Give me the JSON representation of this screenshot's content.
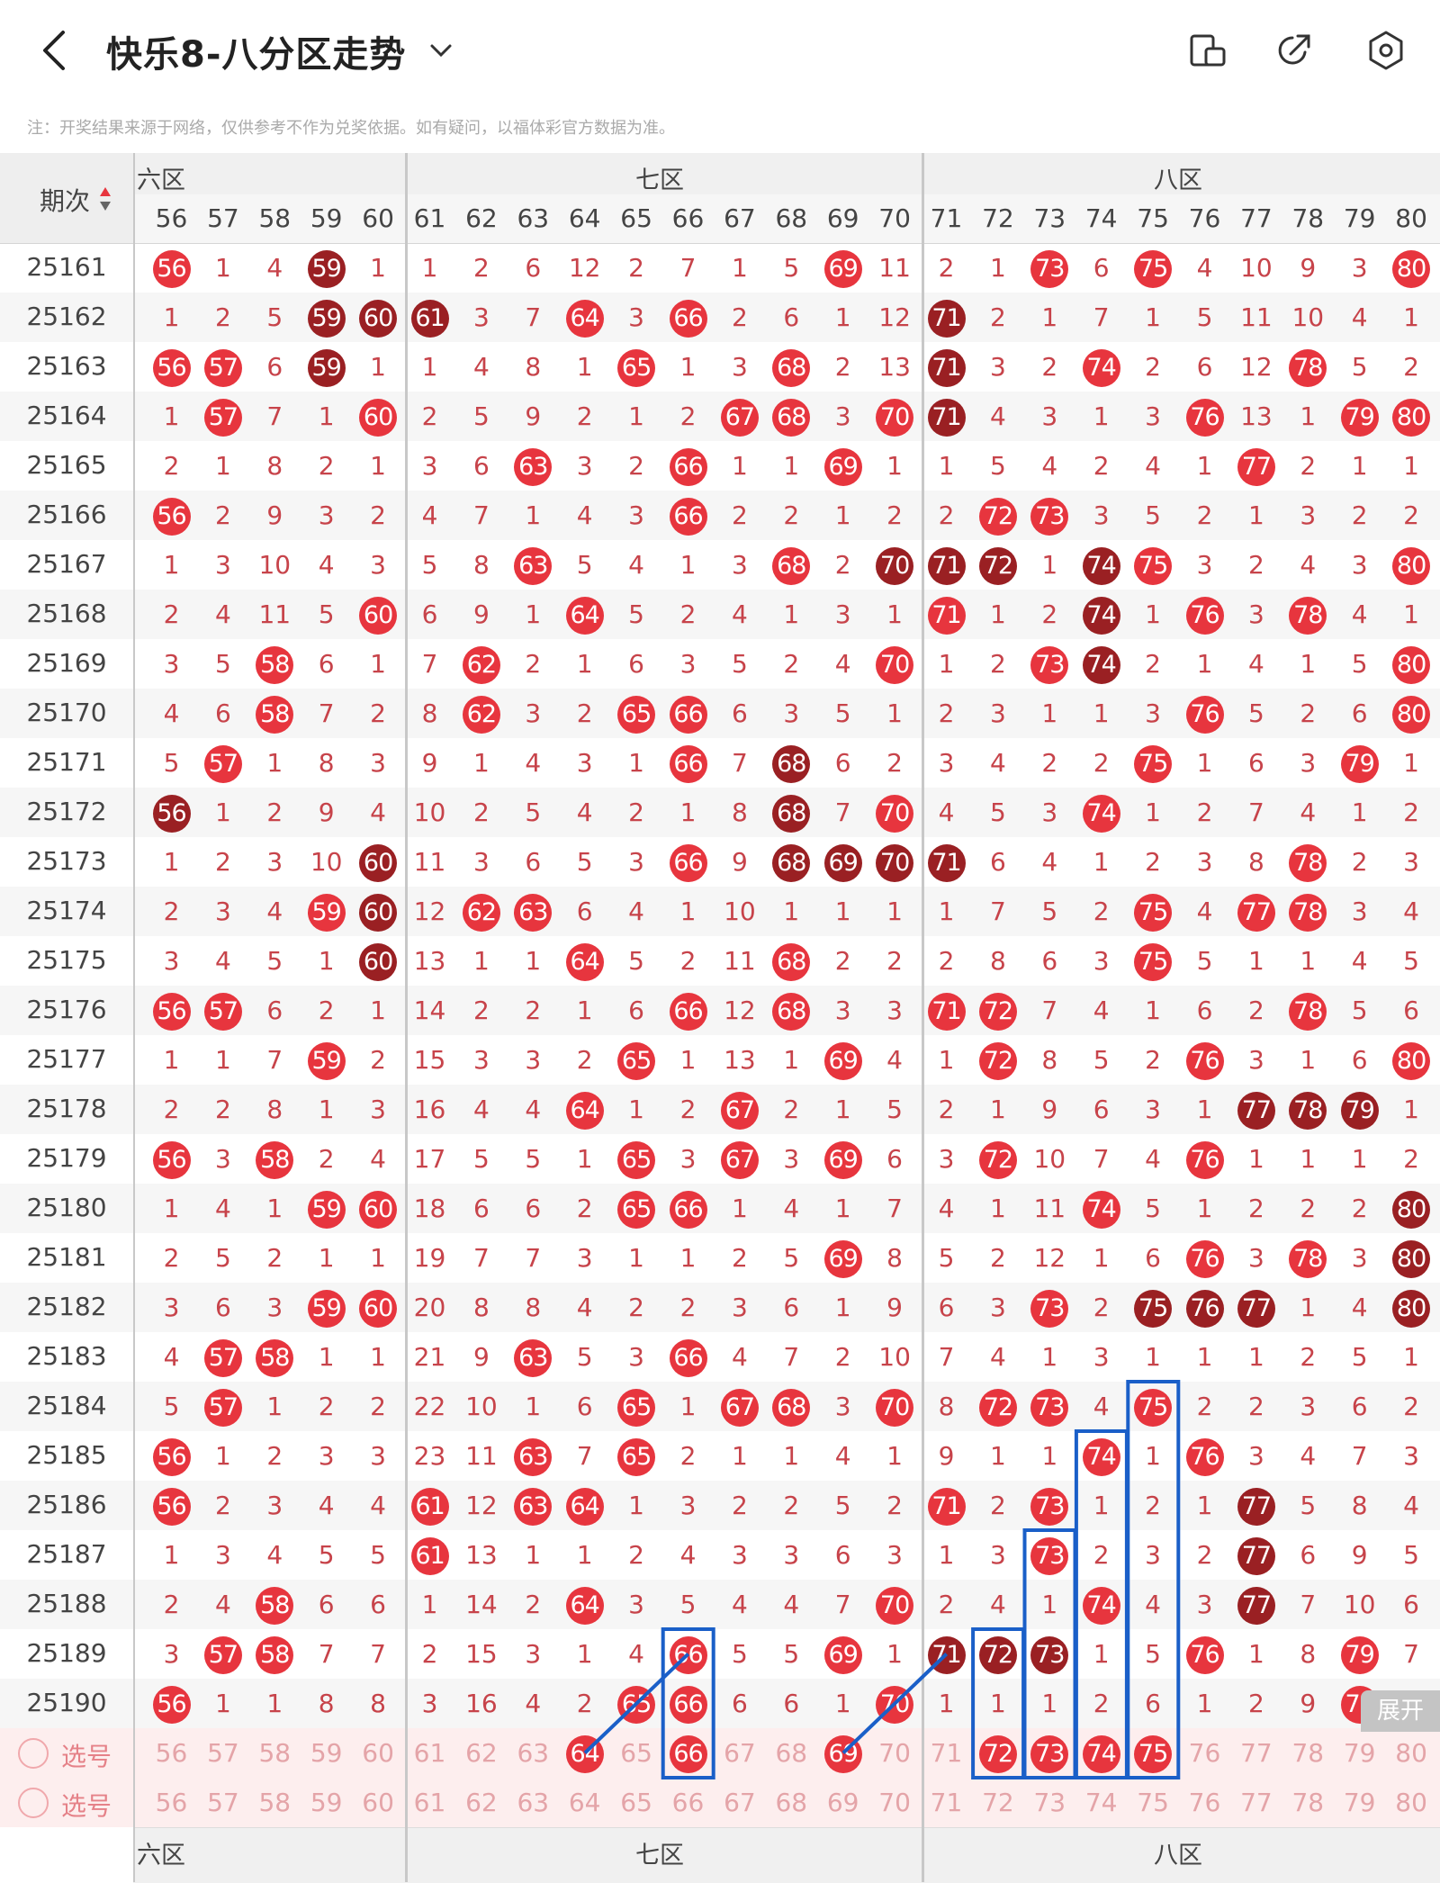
{
  "header": {
    "title": "快乐8-八分区走势",
    "back_icon": "chevron-left-icon",
    "dropdown_icon": "chevron-down-icon",
    "icons": [
      "tablet-icon",
      "share-icon",
      "settings-icon"
    ]
  },
  "note": "注：开奖结果来源于网络，仅供参考不作为兑奖依据。如有疑问，以福体彩官方数据为准。",
  "table": {
    "issue_header": "期次",
    "zones": [
      {
        "label": "六区"
      },
      {
        "label": "七区"
      },
      {
        "label": "八区"
      }
    ],
    "columns": [
      "56",
      "57",
      "58",
      "59",
      "60",
      "61",
      "62",
      "63",
      "64",
      "65",
      "66",
      "67",
      "68",
      "69",
      "70",
      "71",
      "72",
      "73",
      "74",
      "75",
      "76",
      "77",
      "78",
      "79",
      "80"
    ],
    "rows": [
      {
        "issue": "25161",
        "cells": [
          "56r",
          "1",
          "4",
          "59d",
          "1",
          "1",
          "2",
          "6",
          "12",
          "2",
          "7",
          "1",
          "5",
          "69r",
          "11",
          "2",
          "1",
          "73r",
          "6",
          "75r",
          "4",
          "10",
          "9",
          "3",
          "80r"
        ]
      },
      {
        "issue": "25162",
        "cells": [
          "1",
          "2",
          "5",
          "59d",
          "60d",
          "61d",
          "3",
          "7",
          "64r",
          "3",
          "66r",
          "2",
          "6",
          "1",
          "12",
          "71d",
          "2",
          "1",
          "7",
          "1",
          "5",
          "11",
          "10",
          "4",
          "1"
        ]
      },
      {
        "issue": "25163",
        "cells": [
          "56r",
          "57r",
          "6",
          "59d",
          "1",
          "1",
          "4",
          "8",
          "1",
          "65r",
          "1",
          "3",
          "68r",
          "2",
          "13",
          "71d",
          "3",
          "2",
          "74r",
          "2",
          "6",
          "12",
          "78r",
          "5",
          "2"
        ]
      },
      {
        "issue": "25164",
        "cells": [
          "1",
          "57r",
          "7",
          "1",
          "60r",
          "2",
          "5",
          "9",
          "2",
          "1",
          "2",
          "67r",
          "68r",
          "3",
          "70r",
          "71d",
          "4",
          "3",
          "1",
          "3",
          "76r",
          "13",
          "1",
          "79r",
          "80r"
        ]
      },
      {
        "issue": "25165",
        "cells": [
          "2",
          "1",
          "8",
          "2",
          "1",
          "3",
          "6",
          "63r",
          "3",
          "2",
          "66r",
          "1",
          "1",
          "69r",
          "1",
          "1",
          "5",
          "4",
          "2",
          "4",
          "1",
          "77r",
          "2",
          "1",
          "1"
        ]
      },
      {
        "issue": "25166",
        "cells": [
          "56r",
          "2",
          "9",
          "3",
          "2",
          "4",
          "7",
          "1",
          "4",
          "3",
          "66r",
          "2",
          "2",
          "1",
          "2",
          "2",
          "72r",
          "73r",
          "3",
          "5",
          "2",
          "1",
          "3",
          "2",
          "2"
        ]
      },
      {
        "issue": "25167",
        "cells": [
          "1",
          "3",
          "10",
          "4",
          "3",
          "5",
          "8",
          "63r",
          "5",
          "4",
          "1",
          "3",
          "68r",
          "2",
          "70d",
          "71d",
          "72d",
          "1",
          "74d",
          "75r",
          "3",
          "2",
          "4",
          "3",
          "80r"
        ]
      },
      {
        "issue": "25168",
        "cells": [
          "2",
          "4",
          "11",
          "5",
          "60r",
          "6",
          "9",
          "1",
          "64r",
          "5",
          "2",
          "4",
          "1",
          "3",
          "1",
          "71r",
          "1",
          "2",
          "74d",
          "1",
          "76r",
          "3",
          "78r",
          "4",
          "1"
        ]
      },
      {
        "issue": "25169",
        "cells": [
          "3",
          "5",
          "58r",
          "6",
          "1",
          "7",
          "62r",
          "2",
          "1",
          "6",
          "3",
          "5",
          "2",
          "4",
          "70r",
          "1",
          "2",
          "73r",
          "74d",
          "2",
          "1",
          "4",
          "1",
          "5",
          "80r"
        ]
      },
      {
        "issue": "25170",
        "cells": [
          "4",
          "6",
          "58r",
          "7",
          "2",
          "8",
          "62r",
          "3",
          "2",
          "65r",
          "66r",
          "6",
          "3",
          "5",
          "1",
          "2",
          "3",
          "1",
          "1",
          "3",
          "76r",
          "5",
          "2",
          "6",
          "80r"
        ]
      },
      {
        "issue": "25171",
        "cells": [
          "5",
          "57r",
          "1",
          "8",
          "3",
          "9",
          "1",
          "4",
          "3",
          "1",
          "66r",
          "7",
          "68d",
          "6",
          "2",
          "3",
          "4",
          "2",
          "2",
          "75r",
          "1",
          "6",
          "3",
          "79r",
          "1"
        ]
      },
      {
        "issue": "25172",
        "cells": [
          "56d",
          "1",
          "2",
          "9",
          "4",
          "10",
          "2",
          "5",
          "4",
          "2",
          "1",
          "8",
          "68d",
          "7",
          "70r",
          "4",
          "5",
          "3",
          "74r",
          "1",
          "2",
          "7",
          "4",
          "1",
          "2"
        ]
      },
      {
        "issue": "25173",
        "cells": [
          "1",
          "2",
          "3",
          "10",
          "60d",
          "11",
          "3",
          "6",
          "5",
          "3",
          "66r",
          "9",
          "68d",
          "69d",
          "70d",
          "71d",
          "6",
          "4",
          "1",
          "2",
          "3",
          "8",
          "78r",
          "2",
          "3"
        ]
      },
      {
        "issue": "25174",
        "cells": [
          "2",
          "3",
          "4",
          "59r",
          "60d",
          "12",
          "62r",
          "63r",
          "6",
          "4",
          "1",
          "10",
          "1",
          "1",
          "1",
          "1",
          "7",
          "5",
          "2",
          "75r",
          "4",
          "77r",
          "78r",
          "3",
          "4"
        ]
      },
      {
        "issue": "25175",
        "cells": [
          "3",
          "4",
          "5",
          "1",
          "60d",
          "13",
          "1",
          "1",
          "64r",
          "5",
          "2",
          "11",
          "68r",
          "2",
          "2",
          "2",
          "8",
          "6",
          "3",
          "75r",
          "5",
          "1",
          "1",
          "4",
          "5"
        ]
      },
      {
        "issue": "25176",
        "cells": [
          "56r",
          "57r",
          "6",
          "2",
          "1",
          "14",
          "2",
          "2",
          "1",
          "6",
          "66r",
          "12",
          "68r",
          "3",
          "3",
          "71r",
          "72r",
          "7",
          "4",
          "1",
          "6",
          "2",
          "78r",
          "5",
          "6"
        ]
      },
      {
        "issue": "25177",
        "cells": [
          "1",
          "1",
          "7",
          "59r",
          "2",
          "15",
          "3",
          "3",
          "2",
          "65r",
          "1",
          "13",
          "1",
          "69r",
          "4",
          "1",
          "72r",
          "8",
          "5",
          "2",
          "76r",
          "3",
          "1",
          "6",
          "80r"
        ]
      },
      {
        "issue": "25178",
        "cells": [
          "2",
          "2",
          "8",
          "1",
          "3",
          "16",
          "4",
          "4",
          "64r",
          "1",
          "2",
          "67r",
          "2",
          "1",
          "5",
          "2",
          "1",
          "9",
          "6",
          "3",
          "1",
          "77d",
          "78d",
          "79d",
          "1"
        ]
      },
      {
        "issue": "25179",
        "cells": [
          "56r",
          "3",
          "58r",
          "2",
          "4",
          "17",
          "5",
          "5",
          "1",
          "65r",
          "3",
          "67r",
          "3",
          "69r",
          "6",
          "3",
          "72r",
          "10",
          "7",
          "4",
          "76r",
          "1",
          "1",
          "1",
          "2"
        ]
      },
      {
        "issue": "25180",
        "cells": [
          "1",
          "4",
          "1",
          "59r",
          "60r",
          "18",
          "6",
          "6",
          "2",
          "65r",
          "66r",
          "1",
          "4",
          "1",
          "7",
          "4",
          "1",
          "11",
          "74r",
          "5",
          "1",
          "2",
          "2",
          "2",
          "80d"
        ]
      },
      {
        "issue": "25181",
        "cells": [
          "2",
          "5",
          "2",
          "1",
          "1",
          "19",
          "7",
          "7",
          "3",
          "1",
          "1",
          "2",
          "5",
          "69r",
          "8",
          "5",
          "2",
          "12",
          "1",
          "6",
          "76r",
          "3",
          "78r",
          "3",
          "80d"
        ]
      },
      {
        "issue": "25182",
        "cells": [
          "3",
          "6",
          "3",
          "59r",
          "60r",
          "20",
          "8",
          "8",
          "4",
          "2",
          "2",
          "3",
          "6",
          "1",
          "9",
          "6",
          "3",
          "73r",
          "2",
          "75d",
          "76d",
          "77d",
          "1",
          "4",
          "80d"
        ]
      },
      {
        "issue": "25183",
        "cells": [
          "4",
          "57r",
          "58r",
          "1",
          "1",
          "21",
          "9",
          "63r",
          "5",
          "3",
          "66r",
          "4",
          "7",
          "2",
          "10",
          "7",
          "4",
          "1",
          "3",
          "1",
          "1",
          "1",
          "2",
          "5",
          "1"
        ]
      },
      {
        "issue": "25184",
        "cells": [
          "5",
          "57r",
          "1",
          "2",
          "2",
          "22",
          "10",
          "1",
          "6",
          "65r",
          "1",
          "67r",
          "68r",
          "3",
          "70r",
          "8",
          "72r",
          "73r",
          "4",
          "75r",
          "2",
          "2",
          "3",
          "6",
          "2"
        ]
      },
      {
        "issue": "25185",
        "cells": [
          "56r",
          "1",
          "2",
          "3",
          "3",
          "23",
          "11",
          "63r",
          "7",
          "65r",
          "2",
          "1",
          "1",
          "4",
          "1",
          "9",
          "1",
          "1",
          "74r",
          "1",
          "76r",
          "3",
          "4",
          "7",
          "3"
        ]
      },
      {
        "issue": "25186",
        "cells": [
          "56r",
          "2",
          "3",
          "4",
          "4",
          "61r",
          "12",
          "63r",
          "64r",
          "1",
          "3",
          "2",
          "2",
          "5",
          "2",
          "71r",
          "2",
          "73r",
          "1",
          "2",
          "1",
          "77d",
          "5",
          "8",
          "4"
        ]
      },
      {
        "issue": "25187",
        "cells": [
          "1",
          "3",
          "4",
          "5",
          "5",
          "61r",
          "13",
          "1",
          "1",
          "2",
          "4",
          "3",
          "3",
          "6",
          "3",
          "1",
          "3",
          "73r",
          "2",
          "3",
          "2",
          "77d",
          "6",
          "9",
          "5"
        ]
      },
      {
        "issue": "25188",
        "cells": [
          "2",
          "4",
          "58r",
          "6",
          "6",
          "1",
          "14",
          "2",
          "64r",
          "3",
          "5",
          "4",
          "4",
          "7",
          "70r",
          "2",
          "4",
          "1",
          "74r",
          "4",
          "3",
          "77d",
          "7",
          "10",
          "6"
        ]
      },
      {
        "issue": "25189",
        "cells": [
          "3",
          "57r",
          "58r",
          "7",
          "7",
          "2",
          "15",
          "3",
          "1",
          "4",
          "66r",
          "5",
          "5",
          "69r",
          "1",
          "71d",
          "72d",
          "73d",
          "1",
          "5",
          "76r",
          "1",
          "8",
          "79r",
          "7"
        ]
      },
      {
        "issue": "25190",
        "cells": [
          "56r",
          "1",
          "1",
          "8",
          "8",
          "3",
          "16",
          "4",
          "2",
          "65r",
          "66r",
          "6",
          "6",
          "1",
          "70r",
          "1",
          "1",
          "1",
          "2",
          "6",
          "1",
          "2",
          "9",
          "79r",
          "8"
        ]
      }
    ],
    "select_rows": [
      {
        "label": "选号",
        "cells": [
          "56",
          "57",
          "58",
          "59",
          "60",
          "61",
          "62",
          "63",
          "64r",
          "65",
          "66r",
          "67",
          "68",
          "69r",
          "70",
          "71",
          "72r",
          "73r",
          "74r",
          "75r",
          "76",
          "77",
          "78",
          "79",
          "80"
        ]
      },
      {
        "label": "选号",
        "cells": [
          "56",
          "57",
          "58",
          "59",
          "60",
          "61",
          "62",
          "63",
          "64",
          "65",
          "66",
          "67",
          "68",
          "69",
          "70",
          "71",
          "72",
          "73",
          "74",
          "75",
          "76",
          "77",
          "78",
          "79",
          "80"
        ]
      }
    ],
    "expand_label": "展开"
  },
  "colors": {
    "ball_red": "#e7353e",
    "ball_dark": "#9a2023",
    "text_red": "#c7434a",
    "annotation_blue": "#1a5fc8"
  }
}
